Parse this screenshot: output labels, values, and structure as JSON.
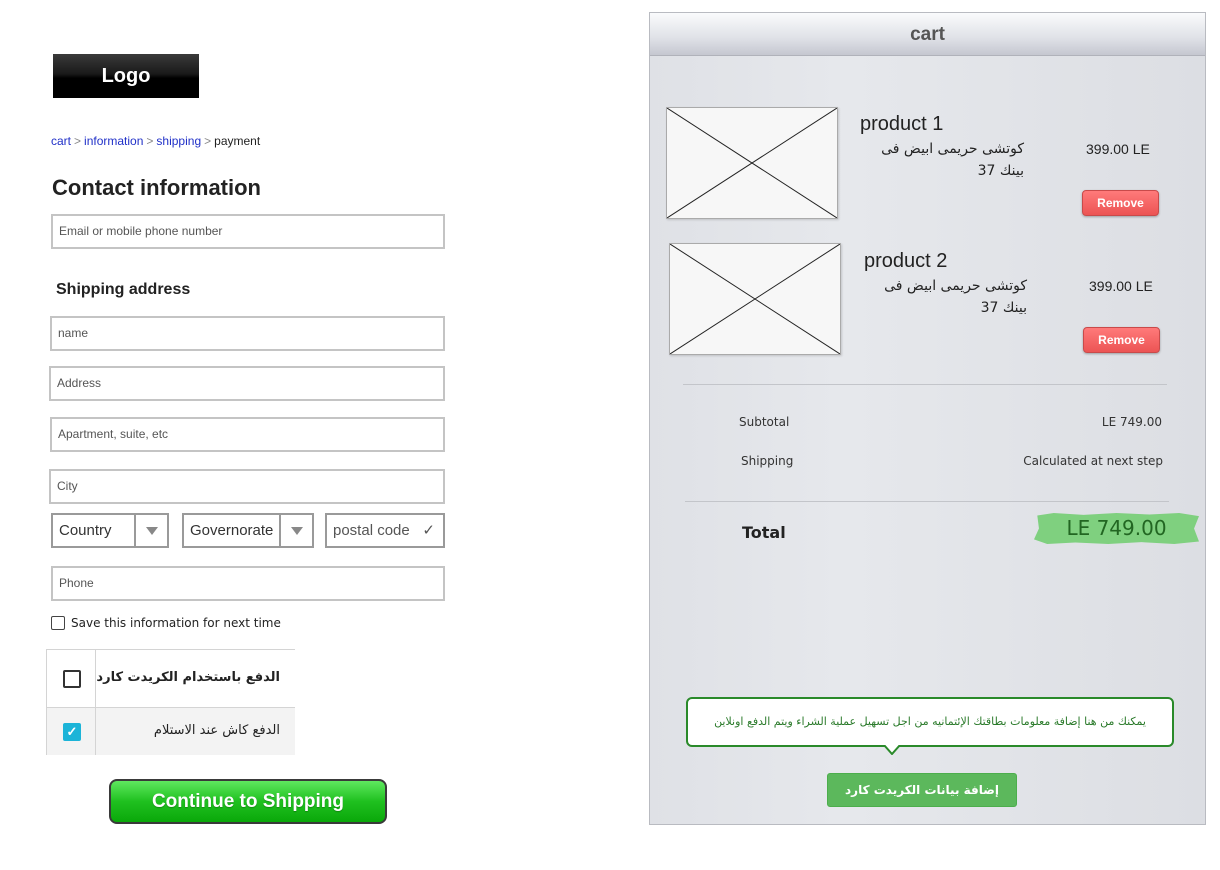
{
  "logo": {
    "text": "Logo"
  },
  "breadcrumb": {
    "items": [
      "cart",
      "information",
      "shipping",
      "payment"
    ],
    "separator": ">"
  },
  "contact": {
    "heading": "Contact information",
    "email_placeholder": "Email or mobile phone number"
  },
  "shipping": {
    "heading": "Shipping address",
    "name_placeholder": "name",
    "address_placeholder": "Address",
    "apartment_placeholder": "Apartment, suite, etc",
    "city_placeholder": "City",
    "country_value": "Country",
    "governorate_value": "Governorate",
    "postal_placeholder": "postal code",
    "postal_check": "✓",
    "phone_placeholder": "Phone",
    "save_label": "Save this information for next time"
  },
  "payment_options": [
    {
      "label": "الدفع باستخدام الكريدت كارد",
      "checked": false
    },
    {
      "label": "الدفع كاش عند الاستلام",
      "checked": true,
      "check_glyph": "✓"
    }
  ],
  "continue_button": {
    "label": "Continue to Shipping"
  },
  "cart": {
    "title": "cart",
    "products": [
      {
        "name": "product 1",
        "description": "كوتشى حريمى ابيض فى بينك 37",
        "price": "399.00 LE",
        "remove_label": "Remove"
      },
      {
        "name": "product 2",
        "description": "كوتشى حريمى ابيض فى بينك 37",
        "price": "399.00 LE",
        "remove_label": "Remove"
      }
    ],
    "subtotal_label": "Subtotal",
    "subtotal_value": "LE 749.00",
    "shipping_label": "Shipping",
    "shipping_value": "Calculated at next step",
    "total_label": "Total",
    "total_value": "LE 749.00",
    "tooltip": "يمكنك من هنا إضافة معلومات بطاقتك الإئتمانيه من اجل تسهيل عملية الشراء ويتم الدفع اونلاين",
    "add_card_label": "إضافة بيانات الكريدت كارد"
  },
  "colors": {
    "continue_green": "#1fc01f",
    "remove_red": "#ec5454",
    "checkbox_blue": "#1cb4d8",
    "link_blue": "#2030c8",
    "total_highlight": "#7fd07f",
    "add_card_green": "#5cb85c"
  }
}
